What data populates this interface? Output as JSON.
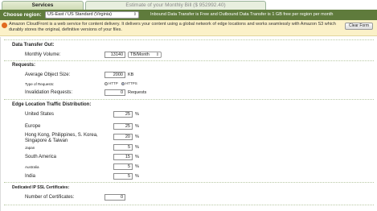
{
  "tabs": {
    "services": "Services",
    "estimate": "Estimate of your Monthly Bill ($ 952992.40)"
  },
  "region": {
    "label": "Choose region:",
    "selected": "US-East / US Standard (Virginia)",
    "note": "Inbound Data Transfer is Free and Outbound Data Transfer is 1 GB free per region per month"
  },
  "service": {
    "description": "Amazon CloudFront is a web service for content delivery. It delivers your content using a global network of edge locations and works seamlessly with Amazon S3 which durably stores the original, definitive versions of your files.",
    "clear_button": "Clear Form"
  },
  "data_transfer_out": {
    "heading": "Data Transfer Out:",
    "monthly_volume_label": "Monthly Volume:",
    "monthly_volume_value": "13140",
    "monthly_volume_unit": "TB/Month"
  },
  "requests": {
    "heading": "Requests:",
    "average_object_size_label": "Average Object Size:",
    "average_object_size_value": "2000",
    "average_object_size_unit": "KB",
    "type_of_requests_label": "Type of Requests:",
    "type_options": [
      "HTTP",
      "HTTPS"
    ],
    "type_selected": "HTTPS",
    "invalidation_label": "Invalidation Requests:",
    "invalidation_value": "0",
    "invalidation_unit": "Requests"
  },
  "edge_distribution": {
    "heading": "Edge Location Traffic Distribution:",
    "unit": "%",
    "regions": [
      {
        "name": "United States",
        "value": "25"
      },
      {
        "name": "Europe",
        "value": "25"
      },
      {
        "name": "Hong Kong, Philippines, S. Korea, Singapore & Taiwan",
        "value": "20"
      },
      {
        "name": "Japan",
        "value": "5"
      },
      {
        "name": "South America",
        "value": "15"
      },
      {
        "name": "Australia",
        "value": "5"
      },
      {
        "name": "India",
        "value": "5"
      }
    ]
  },
  "ssl": {
    "heading": "Dedicated IP SSL Certificates:",
    "certificates_label": "Number of Certificates:",
    "certificates_value": "0"
  },
  "colors": {
    "region_bar": "#5f7b3c",
    "info_banner": "#fbf1c8",
    "tab_active": "#cfdcb6"
  }
}
